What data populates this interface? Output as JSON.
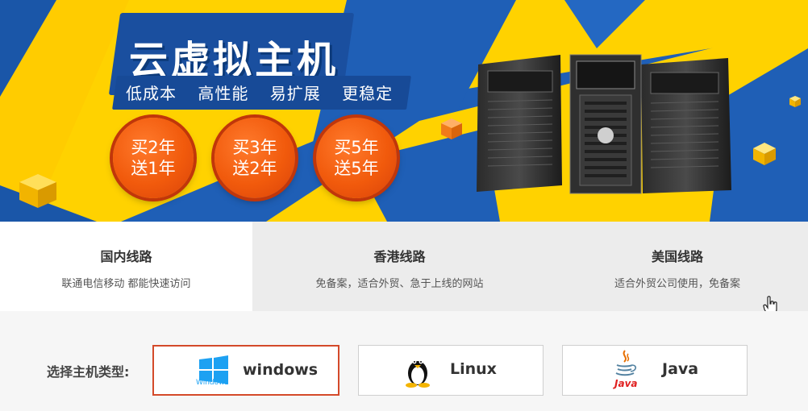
{
  "banner": {
    "title": "云虚拟主机",
    "features": [
      "低成本",
      "高性能",
      "易扩展",
      "更稳定"
    ],
    "promos": [
      {
        "line1": "买2年",
        "line2": "送1年"
      },
      {
        "line1": "买3年",
        "line2": "送2年"
      },
      {
        "line1": "买5年",
        "line2": "送5年"
      }
    ]
  },
  "lines": [
    {
      "title": "国内线路",
      "desc": "联通电信移动 都能快速访问",
      "active": true
    },
    {
      "title": "香港线路",
      "desc": "免备案，适合外贸、急于上线的网站",
      "active": false
    },
    {
      "title": "美国线路",
      "desc": "适合外贸公司使用，免备案",
      "active": false
    }
  ],
  "types": {
    "label": "选择主机类型:",
    "options": [
      {
        "name": "windows",
        "icon": "windows-logo-icon",
        "icon_caption": "Windows",
        "selected": true
      },
      {
        "name": "Linux",
        "icon": "linux-penguin-icon",
        "selected": false
      },
      {
        "name": "Java",
        "icon": "java-logo-icon",
        "icon_caption": "Java",
        "selected": false
      }
    ]
  },
  "colors": {
    "banner_blue": "#1f5fb6",
    "banner_yellow": "#ffd200",
    "promo_orange": "#f15a0c",
    "selected_border": "#d44a2a"
  }
}
